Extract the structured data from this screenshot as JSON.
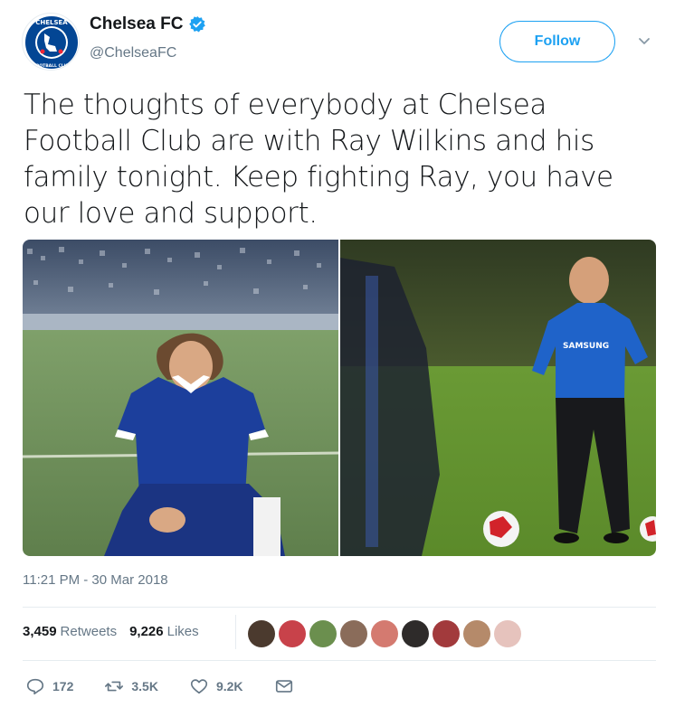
{
  "account": {
    "display_name": "Chelsea FC",
    "handle": "@ChelseaFC",
    "verified": true,
    "avatar_icon": "chelsea-crest",
    "crest_top_text": "CHELSEA",
    "crest_bottom_text": "FOOTBALL CLUB"
  },
  "header": {
    "follow_label": "Follow",
    "menu_icon": "chevron-down-icon"
  },
  "tweet": {
    "text": "The thoughts of everybody at Chelsea Football Club are with Ray Wilkins and his family tonight. Keep fighting Ray, you have our love and support.",
    "timestamp": "11:21 PM - 30 Mar 2018"
  },
  "media": {
    "left_photo": "vintage photo of a Chelsea player kneeling on the pitch",
    "right_photo": "coach in Chelsea training kit on the training pitch",
    "shirt_sponsor": "SAMSUNG"
  },
  "stats": {
    "retweets_count": "3,459",
    "retweets_label": "Retweets",
    "likes_count": "9,226",
    "likes_label": "Likes"
  },
  "actions": {
    "reply_count": "172",
    "retweet_count": "3.5K",
    "like_count": "9.2K"
  },
  "colors": {
    "accent": "#1da1f2",
    "muted": "#657786",
    "border": "#e6ecf0",
    "chelsea_blue": "#034694"
  }
}
